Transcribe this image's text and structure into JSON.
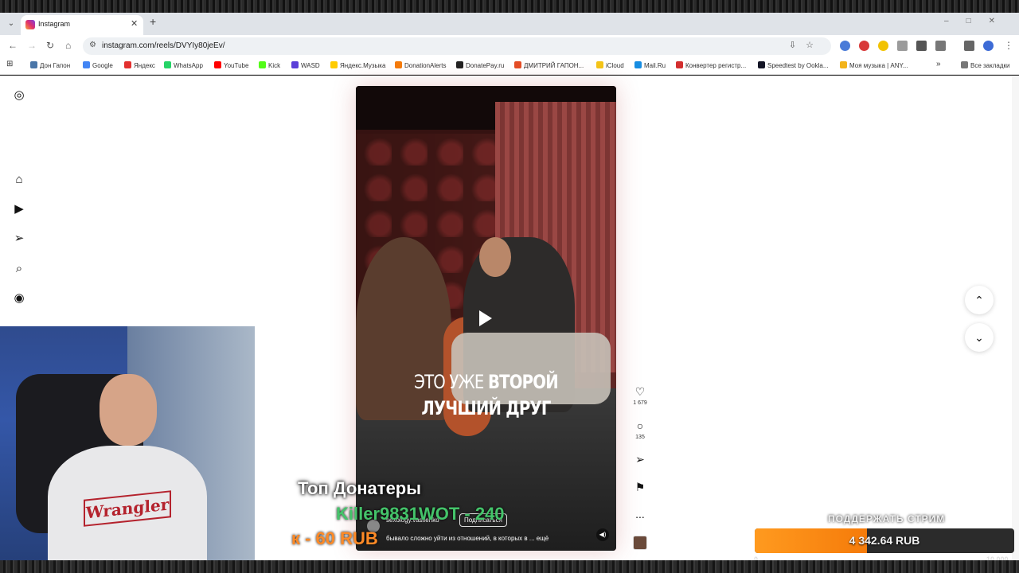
{
  "browser": {
    "tab_title": "Instagram",
    "url": "instagram.com/reels/DVYIy80jeEv/",
    "bookmarks": [
      {
        "label": "Дон Гапон",
        "color": "#4a76a8"
      },
      {
        "label": "Google",
        "color": "#4285f4"
      },
      {
        "label": "Яндекс",
        "color": "#e3302f"
      },
      {
        "label": "WhatsApp",
        "color": "#25d366"
      },
      {
        "label": "YouTube",
        "color": "#ff0000"
      },
      {
        "label": "Kick",
        "color": "#53fc18"
      },
      {
        "label": "WASD",
        "color": "#5a3fd8"
      },
      {
        "label": "Яндекс.Музыка",
        "color": "#ffcc00"
      },
      {
        "label": "DonationAlerts",
        "color": "#f57b0a"
      },
      {
        "label": "DonatePay.ru",
        "color": "#222222"
      },
      {
        "label": "ДМИТРИЙ ГАПОН...",
        "color": "#e44d26"
      },
      {
        "label": "iCloud",
        "color": "#f5c518"
      },
      {
        "label": "Mail.Ru",
        "color": "#168de2"
      },
      {
        "label": "Конвертер регистр...",
        "color": "#d32f2f"
      },
      {
        "label": "Speedtest by Ookla...",
        "color": "#141526"
      },
      {
        "label": "Моя музыка | ANY...",
        "color": "#f3b41b"
      }
    ],
    "all_bookmarks": "Все закладки"
  },
  "reel": {
    "caption_thin": "ЭТО УЖЕ ",
    "caption_bold_1": "ВТОРОЙ",
    "caption_bold_2": "ЛУЧШИЙ ДРУГ",
    "author": "sexology.vasilenko",
    "follow": "Подписаться",
    "description": "бывало сложно уйти из отношений, в которых в ... ещё",
    "likes": "1 679",
    "comments": "135",
    "more": "..."
  },
  "stream": {
    "top_donors_title": "Топ Донатеры",
    "top_donor": "Killer9831WOT - 240",
    "last_donation": "к - 60 RUB",
    "support_title": "ПОДДЕРЖАТЬ СТРИМ",
    "goal_amount": "4 342.64 RUB",
    "goal_min": "0",
    "goal_max": "10 000",
    "goal_progress": 0.434,
    "webcam_shirt_logo": "Wrangler"
  }
}
